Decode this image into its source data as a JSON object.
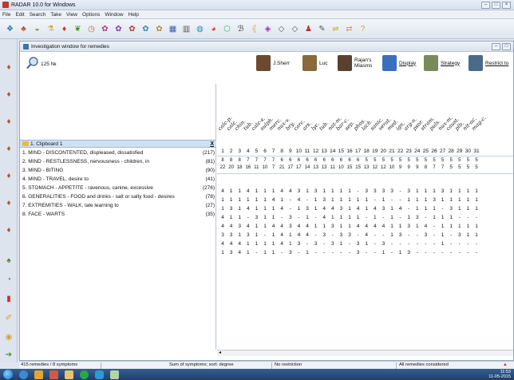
{
  "window": {
    "title": "RADAR 10.0 for Windows"
  },
  "menu": [
    "File",
    "Edit",
    "Search",
    "Take",
    "View",
    "Options",
    "Window",
    "Help"
  ],
  "inner_window": {
    "title": "Investigation window for remedies"
  },
  "inner_toolbar": {
    "remedy_count": "125 №",
    "controls": [
      {
        "label": "J.Sherr",
        "color": "#6b4a2e",
        "underline": false
      },
      {
        "label": "Luc",
        "color": "#8a6a3a",
        "underline": false
      },
      {
        "label": "Rajan's Miasms",
        "color": "#5a4030",
        "underline": false
      },
      {
        "label": "Display",
        "color": "#3a6fc0",
        "underline": true
      },
      {
        "label": "Strategy",
        "color": "#7a8a5a",
        "underline": true
      },
      {
        "label": "Restrict to",
        "color": "#4a6a8a",
        "underline": true
      }
    ]
  },
  "clipboard": {
    "title": "1. Clipboard 1",
    "close": "X"
  },
  "symptoms": [
    {
      "label": "1. MIND - DISCONTENTED, displeased, dissatisfied",
      "count": "(217)"
    },
    {
      "label": "2. MIND - RESTLESSNESS, nervousness - children, in",
      "count": "(81)"
    },
    {
      "label": "3. MIND - BITING",
      "count": "(90)"
    },
    {
      "label": "4. MIND - TRAVEL, desire to",
      "count": "(41)"
    },
    {
      "label": "5. STOMACH - APPETITE - ravenous, canine, excessive",
      "count": "(276)"
    },
    {
      "label": "6. GENERALITIES - FOOD and drinks - salt or salty food - desires",
      "count": "(78)"
    },
    {
      "label": "7. EXTREMITIES - WALK, late learning to",
      "count": "(27)"
    },
    {
      "label": "8. FACE - WARTS",
      "count": "(35)"
    }
  ],
  "remedies": [
    "calc-p.",
    "calc.",
    "chin.",
    "tub.",
    "calc-s.",
    "sulph.",
    "merc.",
    "nux-v.",
    "bry.",
    "carc.",
    "ars.",
    "lyc.",
    "tub.",
    "nat-m.",
    "bar-c.",
    "sep.",
    "phos.",
    "lach.",
    "sanic.",
    "verat.",
    "med.",
    "ign.",
    "arg-n.",
    "psor.",
    "stram.",
    "puls.",
    "nux-m.",
    "caust.",
    "plb.",
    "nit-ac.",
    "mag-c."
  ],
  "col_numbers": [
    "1",
    "2",
    "3",
    "4",
    "5",
    "6",
    "7",
    "8",
    "9",
    "10",
    "11",
    "12",
    "13",
    "14",
    "15",
    "16",
    "17",
    "18",
    "19",
    "20",
    "21",
    "22",
    "23",
    "24",
    "25",
    "26",
    "27",
    "28",
    "29",
    "30",
    "31"
  ],
  "stat_rows": [
    [
      "8",
      "8",
      "8",
      "7",
      "7",
      "7",
      "7",
      "6",
      "6",
      "6",
      "6",
      "6",
      "6",
      "6",
      "6",
      "6",
      "6",
      "5",
      "5",
      "5",
      "5",
      "5",
      "5",
      "5",
      "5",
      "5",
      "5",
      "5",
      "5",
      "5",
      "5"
    ],
    [
      "22",
      "20",
      "18",
      "16",
      "11",
      "10",
      "7",
      "21",
      "17",
      "17",
      "14",
      "13",
      "13",
      "11",
      "10",
      "15",
      "15",
      "13",
      "12",
      "12",
      "10",
      "9",
      "9",
      "9",
      "8",
      "7",
      "7",
      "5",
      "5",
      "5",
      "5"
    ]
  ],
  "grid": [
    [
      "4",
      "1",
      "1",
      "4",
      "1",
      "1",
      "1",
      "4",
      "4",
      "3",
      "1",
      "3",
      "1",
      "1",
      "1",
      "1",
      "-",
      "3",
      "3",
      "3",
      "3",
      "-",
      "3",
      "1",
      "1",
      "1",
      "3",
      "1",
      "1",
      "1",
      "1"
    ],
    [
      "1",
      "1",
      "1",
      "1",
      "1",
      "1",
      "4",
      "1",
      "-",
      "4",
      "-",
      "1",
      "3",
      "1",
      "1",
      "1",
      "1",
      "1",
      "-",
      "1",
      "-",
      "-",
      "1",
      "1",
      "1",
      "3",
      "1",
      "1",
      "1",
      "1",
      "1"
    ],
    [
      "1",
      "3",
      "1",
      "4",
      "1",
      "1",
      "1",
      "4",
      "-",
      "1",
      "3",
      "1",
      "4",
      "4",
      "3",
      "1",
      "4",
      "1",
      "4",
      "3",
      "1",
      "4",
      "-",
      "1",
      "1",
      "1",
      "-",
      "3",
      "1",
      "1",
      "1"
    ],
    [
      "4",
      "1",
      "1",
      "-",
      "3",
      "1",
      "1",
      "-",
      "3",
      "-",
      "1",
      "-",
      "4",
      "1",
      "1",
      "1",
      "1",
      "-",
      "1",
      "-",
      "1",
      "-",
      "1",
      "3",
      "-",
      "1",
      "1",
      "1",
      "-",
      "-",
      "-"
    ],
    [
      "4",
      "4",
      "3",
      "4",
      "1",
      "1",
      "4",
      "4",
      "3",
      "4",
      "4",
      "1",
      "1",
      "3",
      "1",
      "1",
      "4",
      "4",
      "4",
      "4",
      "1",
      "1",
      "3",
      "1",
      "4",
      "-",
      "1",
      "1",
      "1",
      "1",
      "1"
    ],
    [
      "3",
      "3",
      "1",
      "3",
      "1",
      "-",
      "1",
      "4",
      "1",
      "4",
      "4",
      "-",
      "3",
      "-",
      "3",
      "3",
      "-",
      "4",
      "-",
      "-",
      "1",
      "3",
      "-",
      "-",
      "3",
      "-",
      "1",
      "-",
      "3",
      "1",
      "1"
    ],
    [
      "4",
      "4",
      "4",
      "1",
      "1",
      "1",
      "1",
      "4",
      "1",
      "3",
      "-",
      "3",
      "-",
      "3",
      "1",
      "-",
      "3",
      "1",
      "-",
      "3",
      "-",
      "-",
      "-",
      "-",
      "-",
      "-",
      "1",
      "-",
      "-",
      "-",
      "-"
    ],
    [
      "1",
      "3",
      "4",
      "1",
      "-",
      "1",
      "1",
      "-",
      "3",
      "-",
      "1",
      "-",
      "-",
      "-",
      "-",
      "-",
      "3",
      "-",
      "-",
      "1",
      "-",
      "1",
      "3",
      "-",
      "-",
      "-",
      "-",
      "-",
      "-",
      "-",
      "-"
    ]
  ],
  "status": {
    "remedies": "415 remedies / 8 symptoms",
    "sort": "Sum of symptoms; sort: degree",
    "restriction": "No restriction",
    "considered": "All remedies considered"
  },
  "taskbar": {
    "time": "11:53",
    "date": "11-05-2015"
  }
}
